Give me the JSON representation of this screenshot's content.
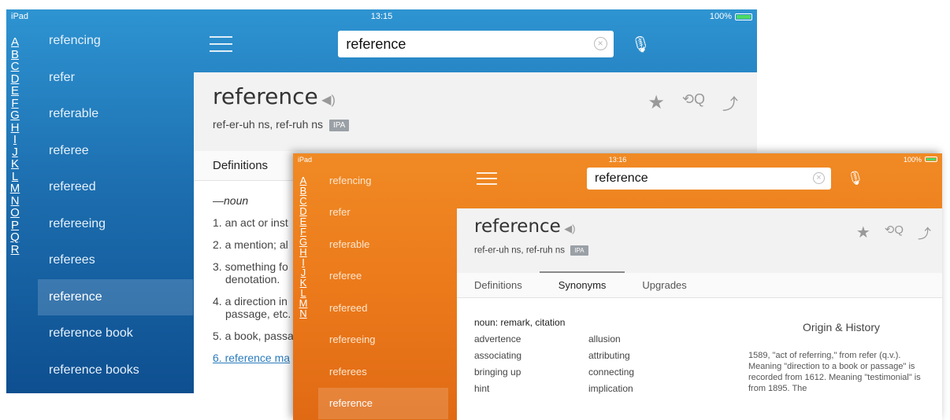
{
  "blue": {
    "status": {
      "left": "iPad",
      "time": "13:15",
      "battery": "100%"
    },
    "alphabet": [
      "A",
      "B",
      "C",
      "D",
      "E",
      "F",
      "G",
      "H",
      "I",
      "J",
      "K",
      "L",
      "M",
      "N",
      "O",
      "P",
      "Q",
      "R"
    ],
    "words": [
      "refencing",
      "refer",
      "referable",
      "referee",
      "refereed",
      "refereeing",
      "referees",
      "reference",
      "reference book",
      "reference books"
    ],
    "search": {
      "value": "reference"
    },
    "entry": {
      "headword": "reference",
      "pron_html": "ref-er-uh ns, ref-ruh ns",
      "ipa": "IPA"
    },
    "tab": "Definitions",
    "definitions": {
      "pos": "—noun",
      "items": [
        "1. an act or inst",
        "2. a mention; al",
        "3. something fo",
        "denotation.",
        "4. a direction in",
        "passage, etc.",
        "5. a book, passa",
        "6. reference ma"
      ]
    }
  },
  "orange": {
    "status": {
      "left": "iPad",
      "time": "13:16",
      "battery": "100%"
    },
    "alphabet": [
      "A",
      "B",
      "C",
      "D",
      "E",
      "F",
      "G",
      "H",
      "I",
      "J",
      "K",
      "L",
      "M",
      "N"
    ],
    "words": [
      "refencing",
      "refer",
      "referable",
      "referee",
      "refereed",
      "refereeing",
      "referees",
      "reference"
    ],
    "search": {
      "value": "reference"
    },
    "entry": {
      "headword": "reference",
      "pron": "ref-er-uh ns, ref-ruh ns",
      "ipa": "IPA"
    },
    "tabs": [
      "Definitions",
      "Synonyms",
      "Upgrades"
    ],
    "synonyms": {
      "heading": "noun: remark, citation",
      "left": [
        "advertence",
        "associating",
        "bringing up",
        "hint"
      ],
      "right": [
        "allusion",
        "attributing",
        "connecting",
        "implication"
      ]
    },
    "origin": {
      "title": "Origin & History",
      "text": "1589, \"act of referring,\" from refer (q.v.). Meaning \"direction to a book or passage\" is recorded from 1612. Meaning \"testimonial\" is from 1895. The"
    }
  }
}
